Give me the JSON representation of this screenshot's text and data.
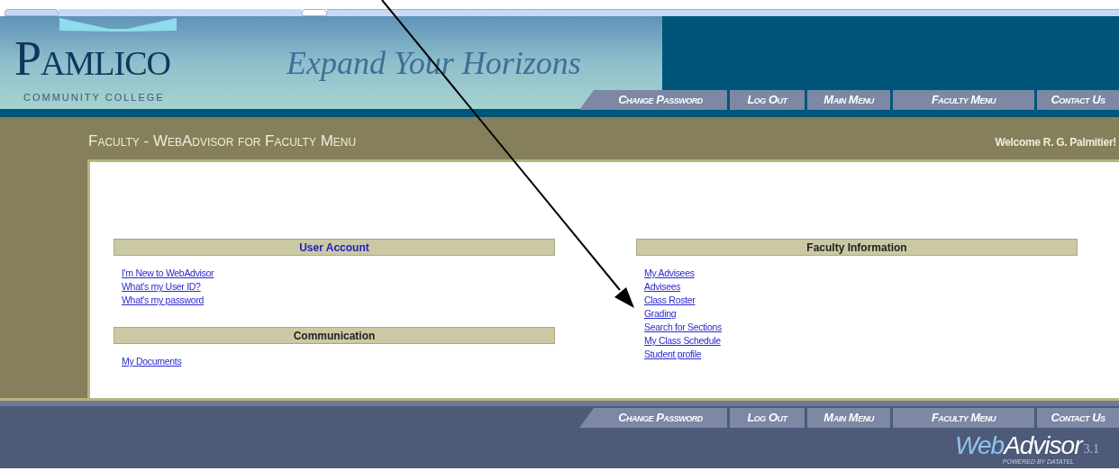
{
  "header": {
    "logo": {
      "name": "Pamlico",
      "subtitle": "COMMUNITY COLLEGE"
    },
    "tagline": "Expand Your Horizons"
  },
  "top_nav": [
    {
      "label": "Change Password"
    },
    {
      "label": "Log Out"
    },
    {
      "label": "Main Menu"
    },
    {
      "label": "Faculty Menu"
    },
    {
      "label": "Contact Us"
    }
  ],
  "page_title": "Faculty - WebAdvisor for Faculty Menu",
  "welcome": "Welcome R. G. Palmitier!",
  "columns": [
    [
      {
        "title": "User Account",
        "title_is_link": true,
        "links": [
          "I'm New to WebAdvisor",
          "What's my User ID?",
          "What's my password"
        ]
      },
      {
        "title": "Communication",
        "title_is_link": false,
        "links": [
          "My Documents"
        ]
      }
    ],
    [
      {
        "title": "Faculty Information",
        "title_is_link": false,
        "links": [
          "My Advisees",
          "Advisees",
          "Class Roster",
          "Grading",
          "Search for Sections",
          "My Class Schedule",
          "Student profile"
        ]
      }
    ]
  ],
  "bottom_nav": [
    {
      "label": "Change Password"
    },
    {
      "label": "Log Out"
    },
    {
      "label": "Main Menu"
    },
    {
      "label": "Faculty Menu"
    },
    {
      "label": "Contact Us"
    }
  ],
  "footer_logo": {
    "name_parts": [
      "Web",
      "Advisor"
    ],
    "version": "3.1",
    "tagline": "POWERED BY DATATEL"
  }
}
